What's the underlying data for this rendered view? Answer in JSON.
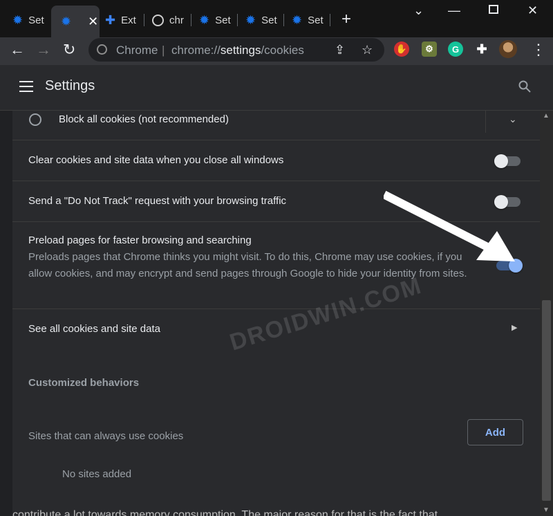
{
  "tabs": [
    {
      "label": "Set",
      "icon": "gear-icon"
    },
    {
      "label": "",
      "icon": "gear-icon",
      "active": true
    },
    {
      "label": "Ext",
      "icon": "puzzle-icon"
    },
    {
      "label": "chr",
      "icon": "globe-icon"
    },
    {
      "label": "Set",
      "icon": "gear-icon"
    },
    {
      "label": "Set",
      "icon": "gear-icon"
    },
    {
      "label": "Set",
      "icon": "gear-icon"
    }
  ],
  "toolbar": {
    "origin": "Chrome",
    "url_prefix": "chrome://",
    "url_host": "settings",
    "url_path": "/cookies"
  },
  "header": {
    "title": "Settings"
  },
  "rows": {
    "block_all": "Block all cookies (not recommended)",
    "clear_on_close": "Clear cookies and site data when you close all windows",
    "do_not_track": "Send a \"Do Not Track\" request with your browsing traffic",
    "preload_title": "Preload pages for faster browsing and searching",
    "preload_desc": "Preloads pages that Chrome thinks you might visit. To do this, Chrome may use cookies, if you allow cookies, and may encrypt and send pages through Google to hide your identity from sites.",
    "see_all": "See all cookies and site data"
  },
  "toggles": {
    "clear_on_close": false,
    "do_not_track": false,
    "preload": true
  },
  "customized": {
    "heading": "Customized behaviors",
    "always_use_label": "Sites that can always use cookies",
    "add_label": "Add",
    "no_sites": "No sites added"
  },
  "watermark": "DROIDWIN.COM",
  "overlay_text": "contribute a lot towards memory consumption. The major reason for that is the fact that"
}
